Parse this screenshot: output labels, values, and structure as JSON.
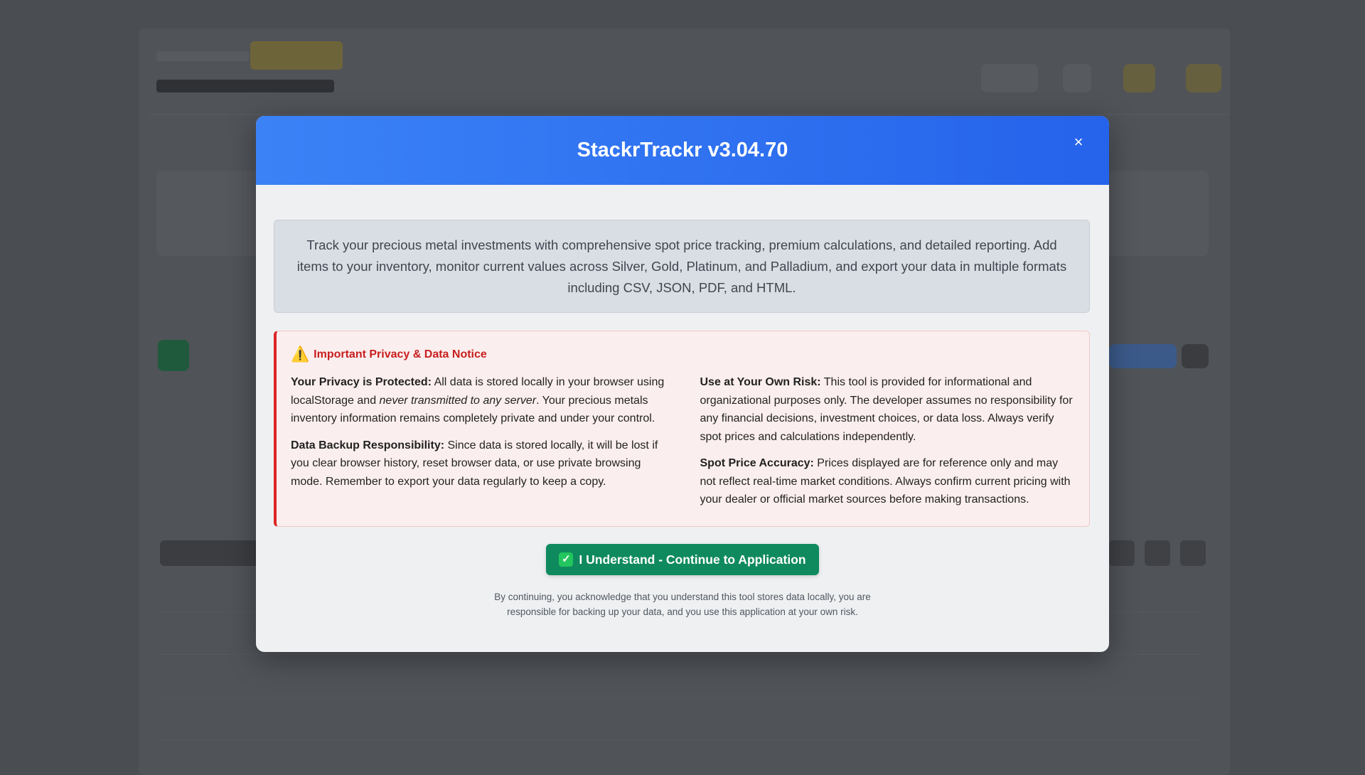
{
  "modal": {
    "title": "StackrTrackr v3.04.70",
    "close_label": "×",
    "intro": "Track your precious metal investments with comprehensive spot price tracking, premium calculations, and detailed reporting. Add items to your inventory, monitor current values across Silver, Gold, Platinum, and Palladium, and export your data in multiple formats including CSV, JSON, PDF, and HTML.",
    "notice": {
      "icon": "⚠️",
      "title": "Important Privacy & Data Notice",
      "privacy": {
        "heading": "Your Privacy is Protected:",
        "text_before": " All data is stored locally in your browser using localStorage and ",
        "emphasis": "never transmitted to any server",
        "text_after": ". Your precious metals inventory information remains completely private and under your control."
      },
      "backup": {
        "heading": "Data Backup Responsibility:",
        "text": " Since data is stored locally, it will be lost if you clear browser history, reset browser data, or use private browsing mode. Remember to export your data regularly to keep a copy."
      },
      "risk": {
        "heading": "Use at Your Own Risk:",
        "text": " This tool is provided for informational and organizational purposes only. The developer assumes no responsibility for any financial decisions, investment choices, or data loss. Always verify spot prices and calculations independently."
      },
      "accuracy": {
        "heading": "Spot Price Accuracy:",
        "text": " Prices displayed are for reference only and may not reflect real-time market conditions. Always confirm current pricing with your dealer or official market sources before making transactions."
      }
    },
    "continue_icon": "✓",
    "continue_label": "I Understand - Continue to Application",
    "footer": "By continuing, you acknowledge that you understand this tool stores data locally, you are responsible for backing up your data, and you use this application at your own risk."
  },
  "colors": {
    "header_start": "#3b82f6",
    "header_end": "#2563eb",
    "notice_accent": "#dc2626",
    "continue_button": "#0f8a5f"
  }
}
